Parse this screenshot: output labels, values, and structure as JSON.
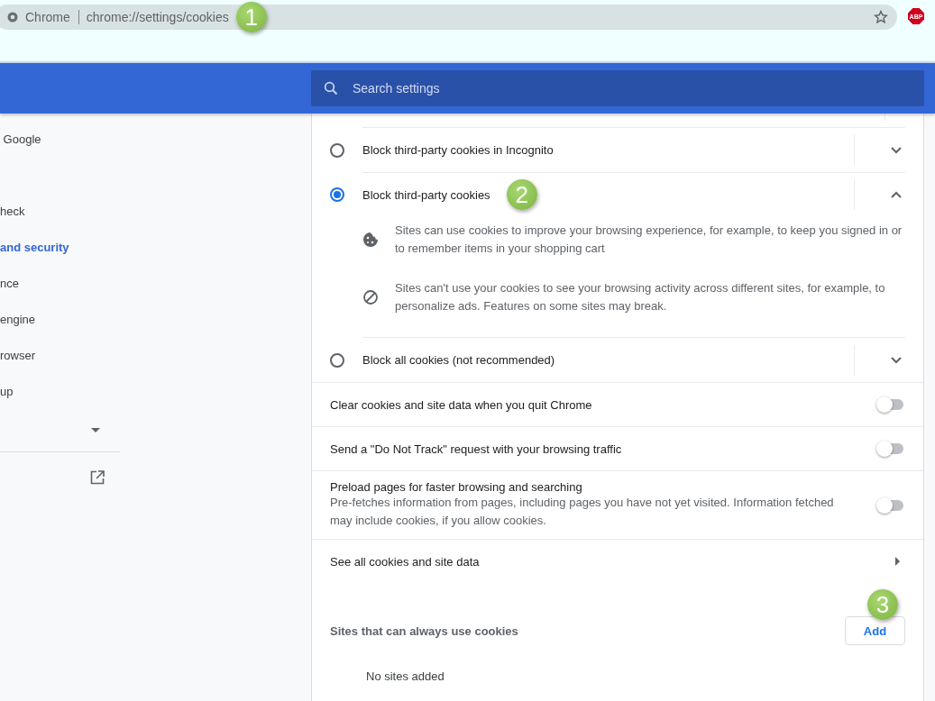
{
  "address_bar": {
    "site_label": "Chrome",
    "url": "chrome://settings/cookies",
    "callout": "1",
    "extension_badge": "ABP"
  },
  "header": {
    "search_placeholder": "Search settings"
  },
  "sidebar": {
    "items": [
      {
        "label": "Google",
        "selected": false
      },
      {
        "label": "heck",
        "selected": false
      },
      {
        "label": "and security",
        "selected": true
      },
      {
        "label": "nce",
        "selected": false
      },
      {
        "label": "engine",
        "selected": false
      },
      {
        "label": "rowser",
        "selected": false
      },
      {
        "label": "up",
        "selected": false
      }
    ]
  },
  "cookie_options": [
    {
      "label": "Block third-party cookies in Incognito",
      "selected": false,
      "expanded": false
    },
    {
      "label": "Block third-party cookies",
      "selected": true,
      "expanded": true,
      "callout": "2",
      "details": [
        {
          "kind": "cookie",
          "text": "Sites can use cookies to improve your browsing experience, for example, to keep you signed in or to remember items in your shopping cart"
        },
        {
          "kind": "block",
          "text": "Sites can't use your cookies to see your browsing activity across different sites, for example, to personalize ads. Features on some sites may break."
        }
      ]
    },
    {
      "label": "Block all cookies (not recommended)",
      "selected": false,
      "expanded": false
    }
  ],
  "toggles": [
    {
      "label": "Clear cookies and site data when you quit Chrome",
      "on": false
    },
    {
      "label": "Send a \"Do Not Track\" request with your browsing traffic",
      "on": false
    },
    {
      "label": "Preload pages for faster browsing and searching",
      "description": "Pre-fetches information from pages, including pages you have not yet visited. Information fetched may include cookies, if you allow cookies.",
      "on": false
    }
  ],
  "link_row": {
    "label": "See all cookies and site data"
  },
  "allow_section": {
    "title": "Sites that can always use cookies",
    "button": "Add",
    "callout": "3",
    "empty_text": "No sites added"
  }
}
